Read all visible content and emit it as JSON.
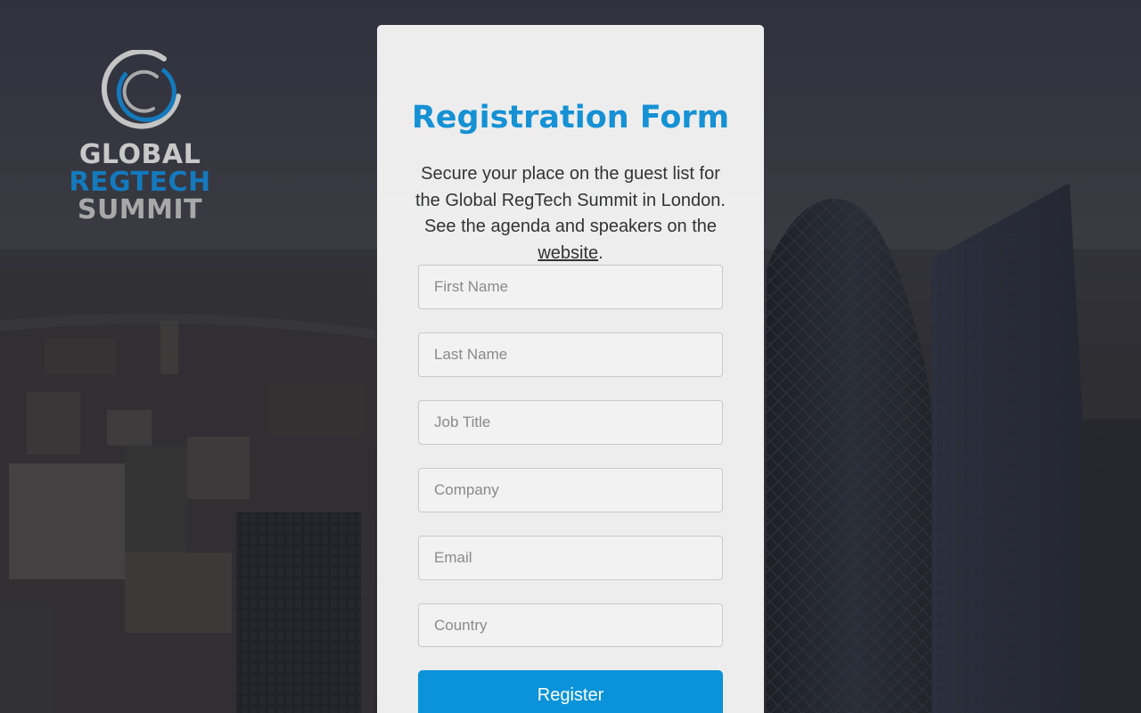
{
  "logo": {
    "line1": "GLOBAL",
    "line2": "REGTECH",
    "line3": "SUMMIT",
    "icon": "ring-logo-icon"
  },
  "form": {
    "title": "Registration Form",
    "description_before_link": "Secure your place on the guest list for the Global RegTech Summit in London. See the agenda and speakers on the ",
    "link_text": "website",
    "description_after_link": ".",
    "fields": [
      {
        "name": "first-name",
        "placeholder": "First Name",
        "value": ""
      },
      {
        "name": "last-name",
        "placeholder": "Last Name",
        "value": ""
      },
      {
        "name": "job-title",
        "placeholder": "Job Title",
        "value": ""
      },
      {
        "name": "company",
        "placeholder": "Company",
        "value": ""
      },
      {
        "name": "email",
        "placeholder": "Email",
        "value": ""
      },
      {
        "name": "country",
        "placeholder": "Country",
        "value": ""
      }
    ],
    "submit_label": "Register"
  },
  "colors": {
    "accent": "#0a93d9",
    "title": "#1591d4",
    "logo_blue": "#1479bd"
  }
}
